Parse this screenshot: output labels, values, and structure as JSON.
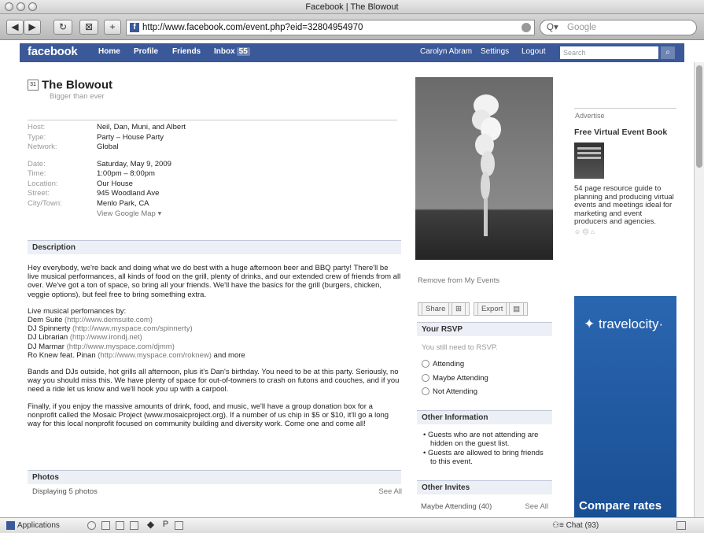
{
  "window": {
    "title": "Facebook | The Blowout",
    "url": "http://www.facebook.com/event.php?eid=32804954970",
    "google_placeholder": "Google"
  },
  "toolbar": {
    "back": "◀",
    "forward": "▶",
    "reload": "↻",
    "bookmark": "⊠",
    "add": "+"
  },
  "fb": {
    "logo": "facebook",
    "nav": [
      "Home",
      "Profile",
      "Friends",
      "Inbox"
    ],
    "inbox_count": "55",
    "user": "Carolyn Abram",
    "settings": "Settings",
    "logout": "Logout",
    "search_placeholder": "Search"
  },
  "event": {
    "title": "The Blowout",
    "tagline": "Bigger than ever",
    "details1": [
      {
        "k": "Host:",
        "v": "Neil, Dan, Muni, and Albert"
      },
      {
        "k": "Type:",
        "v": "Party – House Party"
      },
      {
        "k": "Network:",
        "v": "Global"
      }
    ],
    "details2": [
      {
        "k": "Date:",
        "v": "Saturday, May 9, 2009"
      },
      {
        "k": "Time:",
        "v": "1:00pm – 8:00pm"
      },
      {
        "k": "Location:",
        "v": "Our House"
      },
      {
        "k": "Street:",
        "v": "945 Woodland Ave"
      },
      {
        "k": "City/Town:",
        "v": "Menlo Park, CA"
      }
    ],
    "map_link": "View Google Map ▾"
  },
  "description": {
    "heading": "Description",
    "p1": "Hey everybody, we're back and doing what we do best with a huge afternoon beer and BBQ party! There'll be live musical performances, all kinds of food on the grill, plenty of drinks, and our extended crew of friends from all over. We've got a ton of space, so bring all your friends. We'll have the basics for the grill (burgers, chicken, veggie options), but feel free to bring something extra.",
    "perf_intro": "Live musical perfomances by:",
    "performers": [
      {
        "name": "Dem Suite",
        "link": "(http://www.demsuite.com)"
      },
      {
        "name": "DJ Spinnerty",
        "link": "(http://www.myspace.com/spinnerty)"
      },
      {
        "name": "DJ Librarian",
        "link": "(http://www.irondj.net)"
      },
      {
        "name": "DJ Marmar",
        "link": "(http://www.myspace.com/djmm)"
      },
      {
        "name": "Ro Knew feat. Pinan",
        "link": "(http://www.myspace.com/roknew)",
        "suffix": " and more"
      }
    ],
    "p3": "Bands and DJs outside, hot grills all afternoon, plus it's Dan's birthday. You need to be at this party. Seriously, no way you should miss this. We have plenty of space for out-of-towners to crash on futons and couches, and if you need a ride let us know and we'll hook you up with a carpool.",
    "p4": "Finally, if you enjoy the massive amounts of drink, food, and music, we'll have a group donation box for a nonprofit called the Mosaic Project (www.mosaicproject.org). If a number of us chip in $5 or $10, it'll go a long way for this local nonprofit focused on community building and diversity work. Come one and come all!"
  },
  "photos": {
    "heading": "Photos",
    "count": "Displaying 5 photos",
    "see_all": "See All"
  },
  "sidebar": {
    "remove": "Remove from My Events",
    "share": "Share",
    "export": "Export",
    "rsvp_heading": "Your RSVP",
    "rsvp_note": "You still need to RSVP.",
    "rsvp_options": [
      "Attending",
      "Maybe Attending",
      "Not Attending"
    ],
    "other_info_heading": "Other Information",
    "other_info": [
      "Guests who are not attending are hidden on the guest list.",
      "Guests are allowed to bring friends to this event."
    ],
    "invites_heading": "Other Invites",
    "maybe": "Maybe Attending (40)",
    "see_all": "See All"
  },
  "ads": {
    "label": "Advertise",
    "title": "Free Virtual Event Book",
    "text": "54 page resource guide to planning and producing virtual events and meetings ideal for marketing and event producers and agencies.",
    "brand": "✦ travelocity·",
    "banner_text": "Compare rates"
  },
  "bottom": {
    "applications": "Applications",
    "chat": "Chat (93)"
  }
}
